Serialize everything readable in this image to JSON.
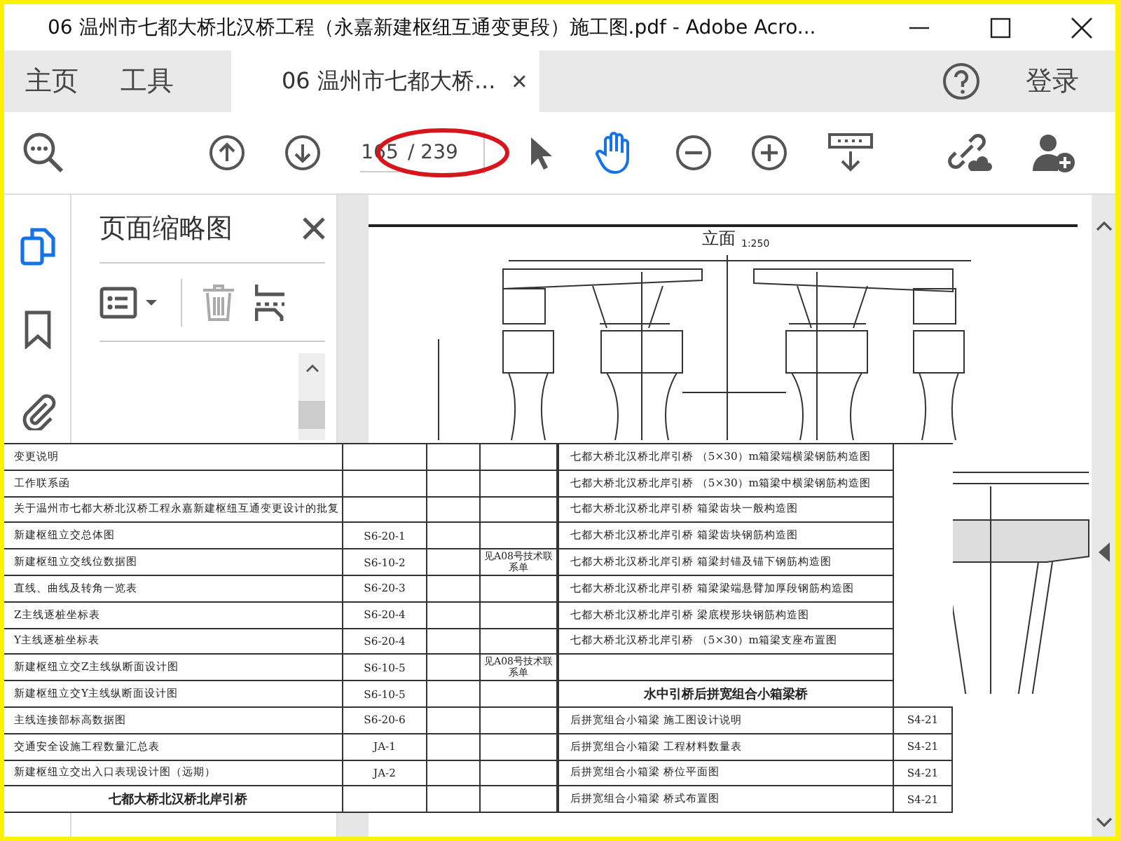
{
  "window": {
    "title": "06 温州市七都大桥北汉桥工程（永嘉新建枢纽互通变更段）施工图.pdf - Adobe Acro..."
  },
  "tabs": [
    {
      "label": "主页",
      "selected": false
    },
    {
      "label": "工具",
      "selected": false
    },
    {
      "label": "06 温州市七都大桥...",
      "selected": true
    }
  ],
  "sign_in": "登录",
  "toolbar": {
    "page_number": "165",
    "page_total": "/ 239"
  },
  "panel": {
    "title": "页面缩略图"
  },
  "drawing": {
    "title": "立面",
    "scale": "1:250"
  },
  "left_table": [
    {
      "name": "变更说明"
    },
    {
      "name": "工作联系函"
    },
    {
      "name": "关于温州市七都大桥北汉桥工程永嘉新建枢纽互通变更设计的批复"
    },
    {
      "name": "新建枢纽立交总体图",
      "number": "S6-20-1"
    },
    {
      "name": "新建枢纽立交线位数据图",
      "number": "S6-10-2",
      "remark": "见A08号技术联系单"
    },
    {
      "name": "直线、曲线及转角一览表",
      "number": "S6-20-3"
    },
    {
      "name": "Z主线逐桩坐标表",
      "number": "S6-20-4"
    },
    {
      "name": "Y主线逐桩坐标表",
      "number": "S6-20-4"
    },
    {
      "name": "新建枢纽立交Z主线纵断面设计图",
      "number": "S6-10-5",
      "remark": "见A08号技术联系单"
    },
    {
      "name": "新建枢纽立交Y主线纵断面设计图",
      "number": "S6-10-5"
    },
    {
      "name": "主线连接部标高数据图",
      "number": "S6-20-6"
    },
    {
      "name": "交通安全设施工程数量汇总表",
      "number": "JA-1"
    },
    {
      "name": "新建枢纽立交出入口表现设计图（远期）",
      "number": "JA-2"
    },
    {
      "name": "七都大桥北汉桥北岸引桥",
      "kind": "heading"
    }
  ],
  "right_table": [
    {
      "name": "七都大桥北汉桥北岸引桥 （5×30）m箱梁端横梁钢筋构造图"
    },
    {
      "name": "七都大桥北汉桥北岸引桥 （5×30）m箱梁中横梁钢筋构造图"
    },
    {
      "name": "七都大桥北汉桥北岸引桥 箱梁齿块一般构造图"
    },
    {
      "name": "七都大桥北汉桥北岸引桥 箱梁齿块钢筋构造图"
    },
    {
      "name": "七都大桥北汉桥北岸引桥 箱梁封锚及锚下钢筋构造图"
    },
    {
      "name": "七都大桥北汉桥北岸引桥 箱梁梁端悬臂加厚段钢筋构造图"
    },
    {
      "name": "七都大桥北汉桥北岸引桥 梁底楔形块钢筋构造图"
    },
    {
      "name": "七都大桥北汉桥北岸引桥 （5×30）m箱梁支座布置图"
    },
    {
      "kind": "blank"
    },
    {
      "name": "水中引桥后拼宽组合小箱梁桥",
      "kind": "heading"
    },
    {
      "name": "后拼宽组合小箱梁 施工图设计说明",
      "number": "S4-21"
    },
    {
      "name": "后拼宽组合小箱梁 工程材料数量表",
      "number": "S4-21"
    },
    {
      "name": "后拼宽组合小箱梁 桥位平面图",
      "number": "S4-21"
    },
    {
      "name": "后拼宽组合小箱梁 桥式布置图",
      "number": "S4-21"
    }
  ]
}
